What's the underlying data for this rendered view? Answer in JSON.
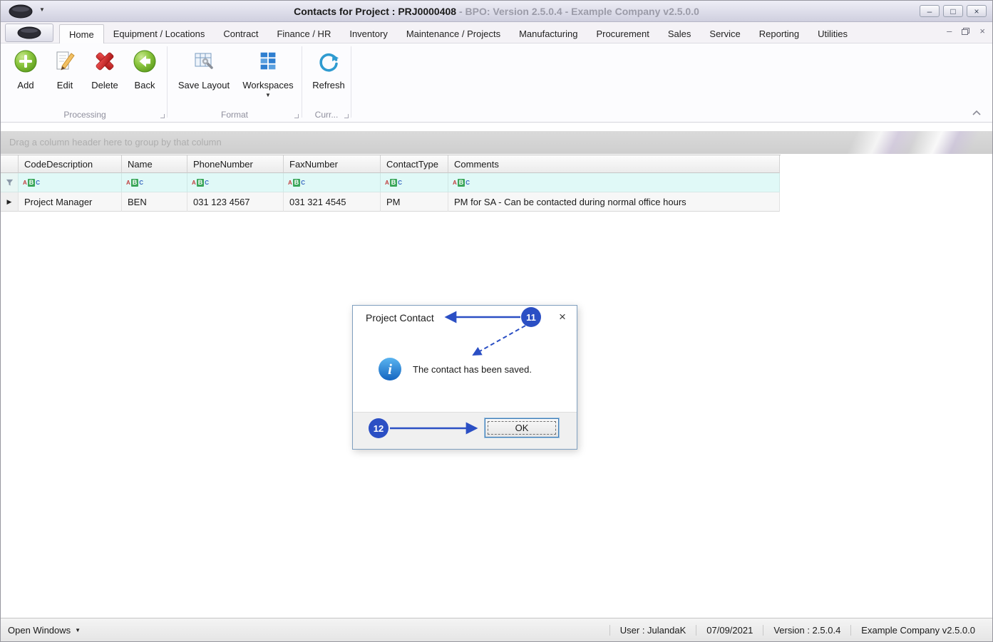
{
  "titlebar": {
    "title_main": "Contacts for Project : PRJ0000408",
    "title_sub": " - BPO: Version 2.5.0.4 - Example Company v2.5.0.0"
  },
  "icons": {
    "minimize": "–",
    "maximize": "□",
    "close": "×",
    "caret_down": "▼",
    "row_indicator": "▶"
  },
  "tabs": [
    {
      "label": "Home"
    },
    {
      "label": "Equipment / Locations"
    },
    {
      "label": "Contract"
    },
    {
      "label": "Finance / HR"
    },
    {
      "label": "Inventory"
    },
    {
      "label": "Maintenance / Projects"
    },
    {
      "label": "Manufacturing"
    },
    {
      "label": "Procurement"
    },
    {
      "label": "Sales"
    },
    {
      "label": "Service"
    },
    {
      "label": "Reporting"
    },
    {
      "label": "Utilities"
    }
  ],
  "ribbon": {
    "buttons": [
      {
        "label": "Add"
      },
      {
        "label": "Edit"
      },
      {
        "label": "Delete"
      },
      {
        "label": "Back"
      },
      {
        "label": "Save Layout"
      },
      {
        "label": "Workspaces"
      },
      {
        "label": "Refresh"
      }
    ],
    "groups": [
      {
        "label": "Processing"
      },
      {
        "label": "Format"
      },
      {
        "label": "Curr..."
      }
    ]
  },
  "grid": {
    "group_hint": "Drag a column header here to group by that column",
    "columns": [
      {
        "label": "CodeDescription"
      },
      {
        "label": "Name"
      },
      {
        "label": "PhoneNumber"
      },
      {
        "label": "FaxNumber"
      },
      {
        "label": "ContactType"
      },
      {
        "label": "Comments"
      }
    ],
    "filter_badge": {
      "a": "A",
      "b": "B",
      "c": "C"
    },
    "rows": [
      {
        "cells": [
          "Project Manager",
          "BEN",
          "031 123 4567",
          "031 321 4545",
          "PM",
          "PM for SA - Can be contacted during normal office hours"
        ]
      }
    ]
  },
  "dialog": {
    "title": "Project Contact",
    "message": "The contact has been saved.",
    "ok": "OK"
  },
  "annotations": {
    "n1": "11",
    "n2": "12"
  },
  "statusbar": {
    "open_windows": "Open Windows",
    "user": "User : JulandaK",
    "date": "07/09/2021",
    "version": "Version : 2.5.0.4",
    "company": "Example Company v2.5.0.0"
  },
  "colors": {
    "annotation": "#2b4fc4",
    "filter_row": "#e0f9f7",
    "info_icon": "#1f7ad0"
  }
}
